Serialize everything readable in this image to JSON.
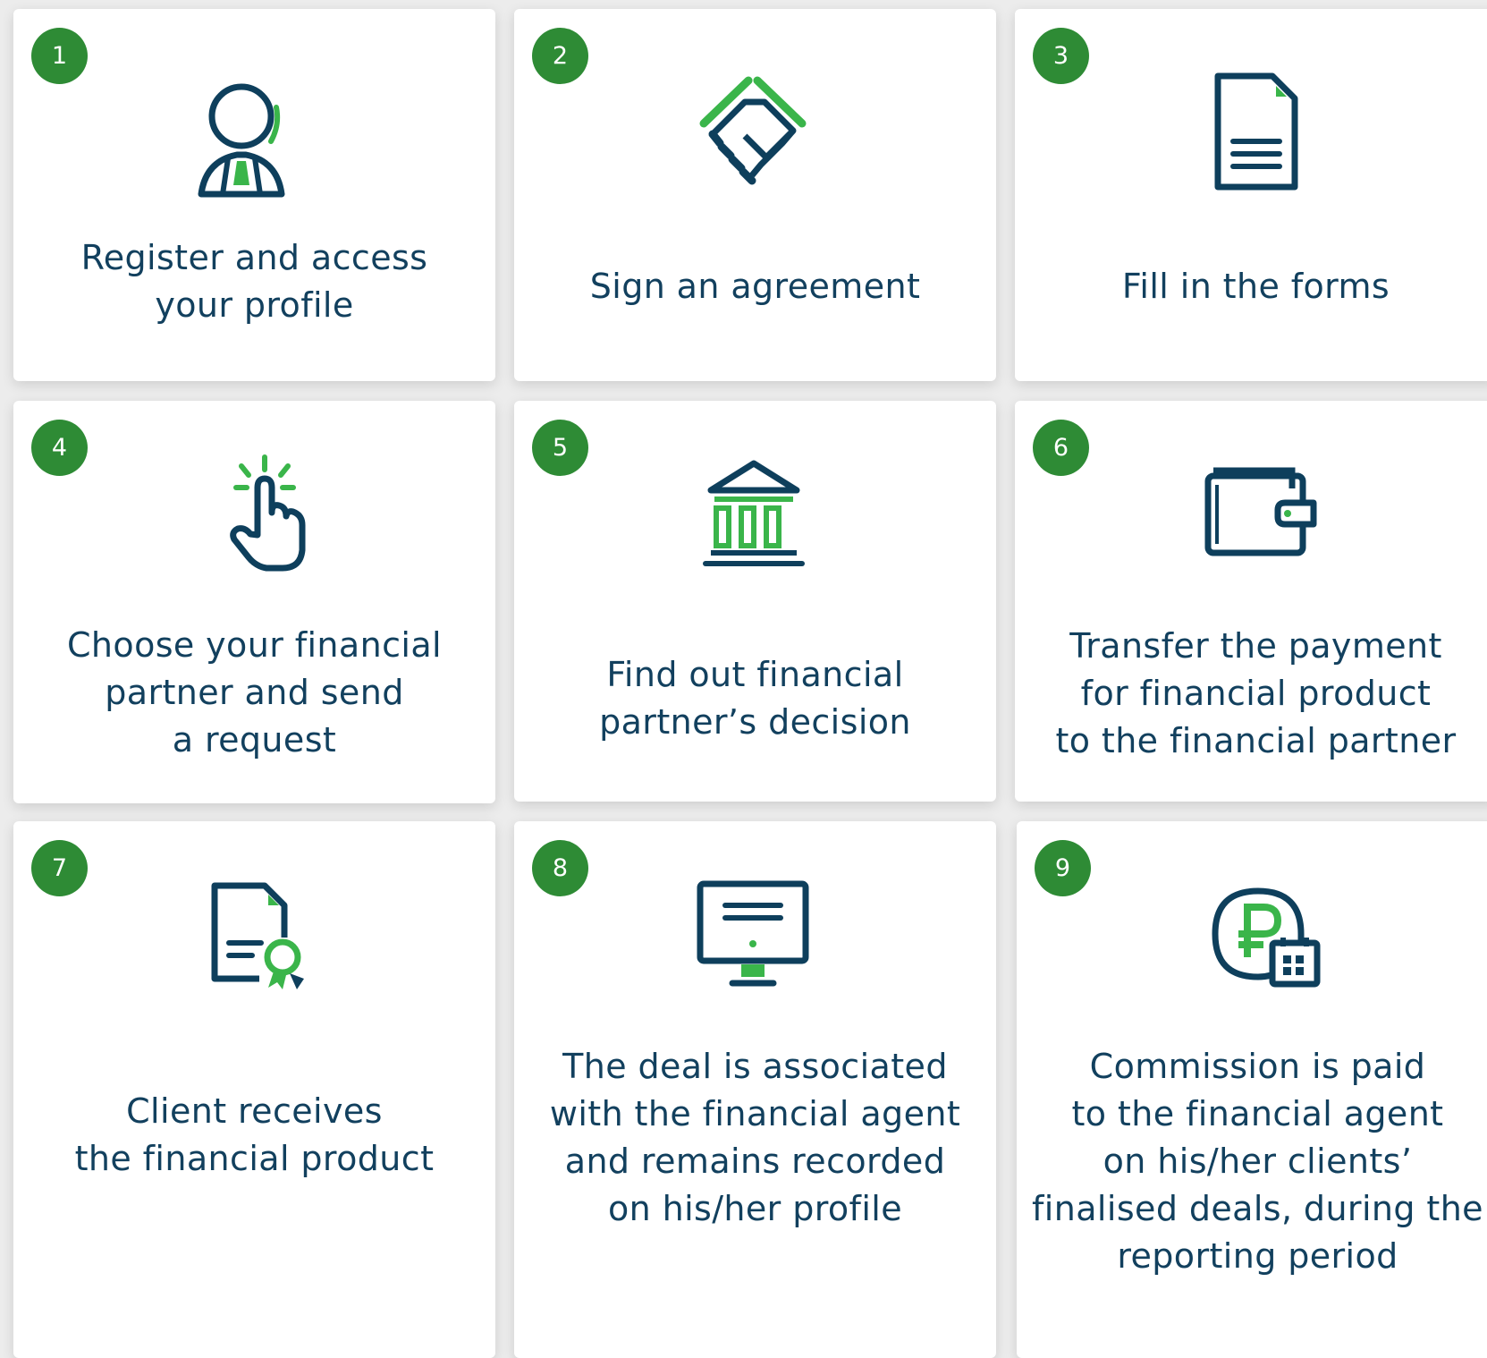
{
  "colors": {
    "accent": "#3ab54a",
    "brand": "#0e3f5c",
    "badge": "#2e8b35",
    "text": "#12405e"
  },
  "steps": [
    {
      "number": "1",
      "icon": "user-profile-icon",
      "lines": [
        "Register and access",
        "your profile"
      ]
    },
    {
      "number": "2",
      "icon": "handshake-icon",
      "lines": [
        "Sign an agreement"
      ]
    },
    {
      "number": "3",
      "icon": "document-icon",
      "lines": [
        "Fill in the forms"
      ]
    },
    {
      "number": "4",
      "icon": "pointer-click-icon",
      "lines": [
        "Choose your financial",
        "partner and send",
        "a request"
      ]
    },
    {
      "number": "5",
      "icon": "bank-icon",
      "lines": [
        "Find out financial",
        "partner’s decision"
      ]
    },
    {
      "number": "6",
      "icon": "wallet-icon",
      "lines": [
        "Transfer the payment",
        "for financial product",
        "to the financial partner"
      ]
    },
    {
      "number": "7",
      "icon": "certificate-icon",
      "lines": [
        "Client receives",
        "the financial product"
      ]
    },
    {
      "number": "8",
      "icon": "monitor-icon",
      "lines": [
        "The deal is associated",
        "with the financial agent",
        "and remains recorded",
        "on his/her profile"
      ]
    },
    {
      "number": "9",
      "icon": "ruble-calendar-icon",
      "lines": [
        "Commission is paid",
        "to the financial agent",
        "on his/her clients’",
        "finalised deals, during the",
        "reporting period"
      ]
    }
  ]
}
